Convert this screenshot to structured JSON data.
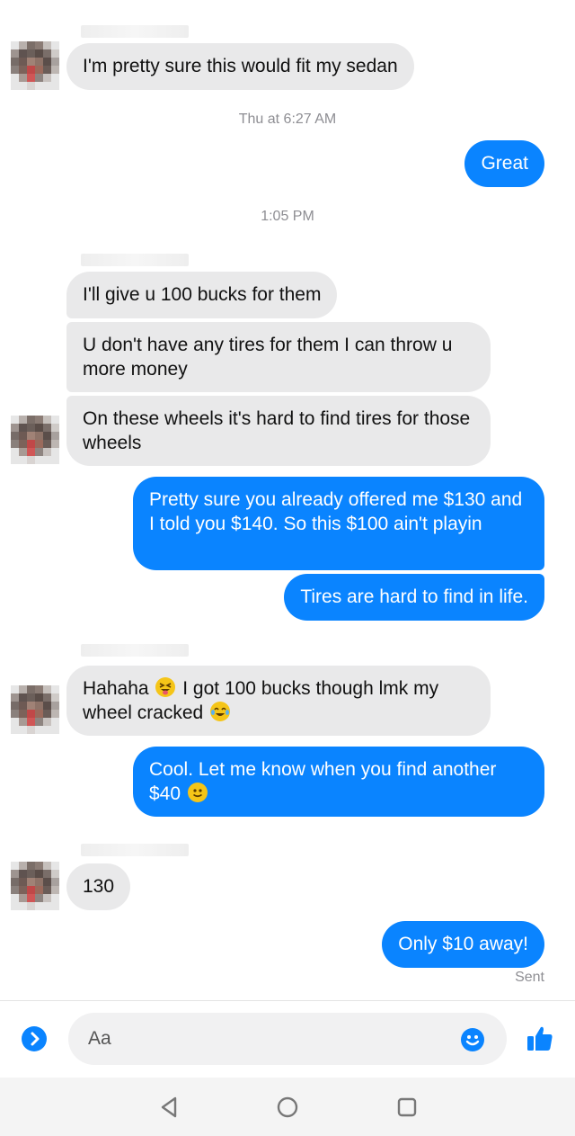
{
  "messages": [
    {
      "text": "I'm pretty sure this would fit my sedan"
    },
    {
      "text": "Great"
    },
    {
      "text": "I'll give u 100 bucks for them"
    },
    {
      "text": "U don't have any tires for them I can throw u more money"
    },
    {
      "text": "On these wheels it's hard to find tires for those wheels"
    },
    {
      "text": "Pretty sure you already offered me $130 and I told you $140. So this $100 ain't playin"
    },
    {
      "text": "Tires are hard to find in life."
    },
    {
      "text_a": "Hahaha",
      "text_b": "I got 100 bucks though lmk my wheel cracked"
    },
    {
      "text": "Cool. Let me know when you find another $40"
    },
    {
      "text": "130"
    },
    {
      "text": "Only $10 away!"
    }
  ],
  "timestamps": [
    "Thu at 6:27 AM",
    "1:05 PM"
  ],
  "status": "Sent",
  "composer": {
    "placeholder": "Aa"
  },
  "colors": {
    "outgoing": "#0a84ff",
    "incoming": "#e9e9ea",
    "accent": "#0a84ff"
  },
  "icons": {
    "more": "chevron-right-icon",
    "emoji": "smiley-icon",
    "like": "thumbs-up-icon",
    "back": "nav-back-icon",
    "home": "nav-home-icon",
    "recents": "nav-recents-icon"
  }
}
